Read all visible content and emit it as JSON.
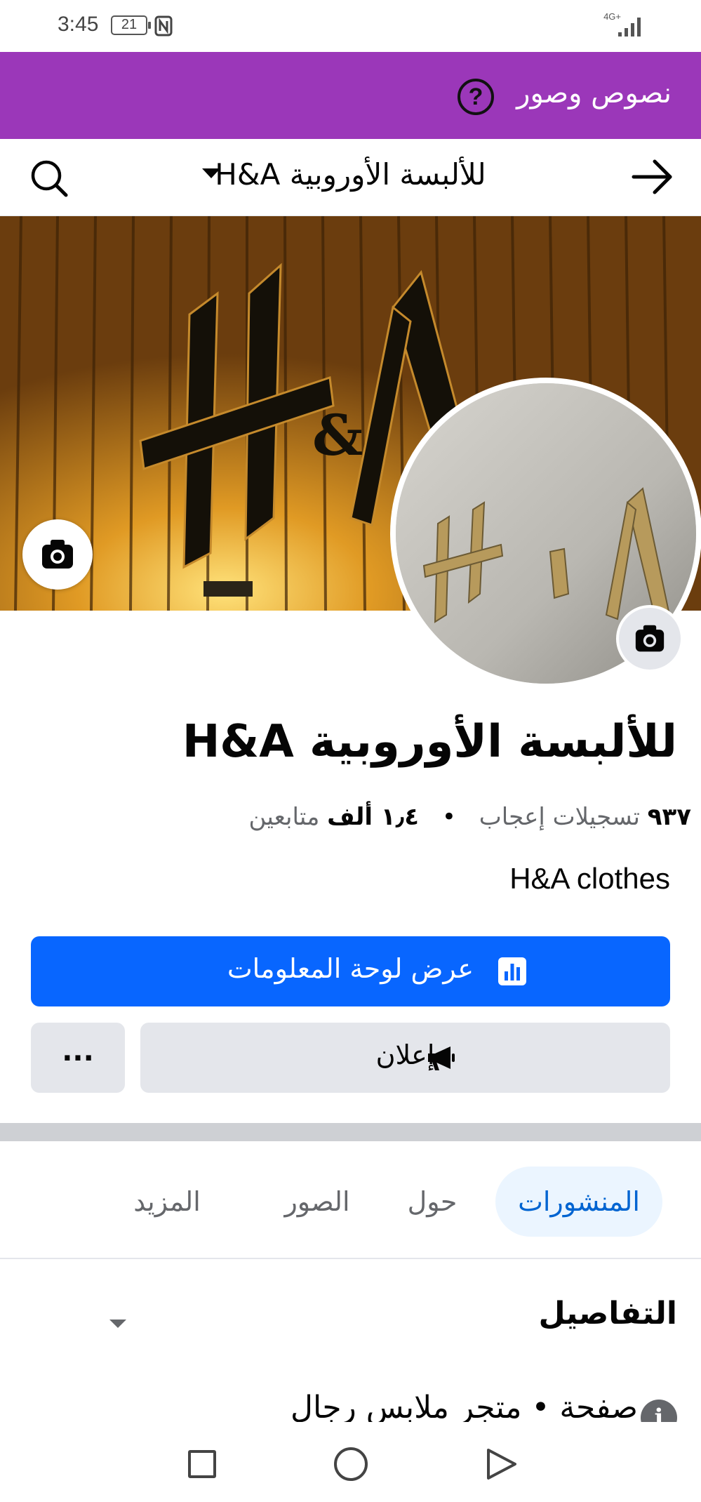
{
  "status_bar": {
    "time": "3:45",
    "battery": "21",
    "network": "4G+"
  },
  "banner": {
    "label": "نصوص وصور",
    "help_icon": "question-circle-icon",
    "color": "#9b37b9"
  },
  "header": {
    "title": "H&A للألبسة الأوروبية",
    "back_icon": "arrow-right-icon",
    "search_icon": "search-icon",
    "dropdown_icon": "caret-down-icon"
  },
  "page": {
    "name": "H&A للألبسة الأوروبية",
    "likes_value": "٩٣٧",
    "likes_label": "تسجيلات إعجاب",
    "separator": "•",
    "followers_value": "١٫٤ ألف",
    "followers_label": "متابعين",
    "bio": "H&A clothes"
  },
  "actions": {
    "dashboard_label": "عرض لوحة المعلومات",
    "dashboard_icon": "bar-chart-icon",
    "ad_label": "إعلان",
    "ad_icon": "megaphone-icon",
    "more_label": "...",
    "accent_color": "#0866ff"
  },
  "tabs": [
    {
      "label": "المنشورات",
      "active": true
    },
    {
      "label": "حول",
      "active": false
    },
    {
      "label": "الصور",
      "active": false
    },
    {
      "label": "المزيد",
      "active": false
    }
  ],
  "details": {
    "title": "التفاصيل",
    "row_text": "صفحة • متجر ملابس رجال",
    "row_icon": "info-icon"
  }
}
